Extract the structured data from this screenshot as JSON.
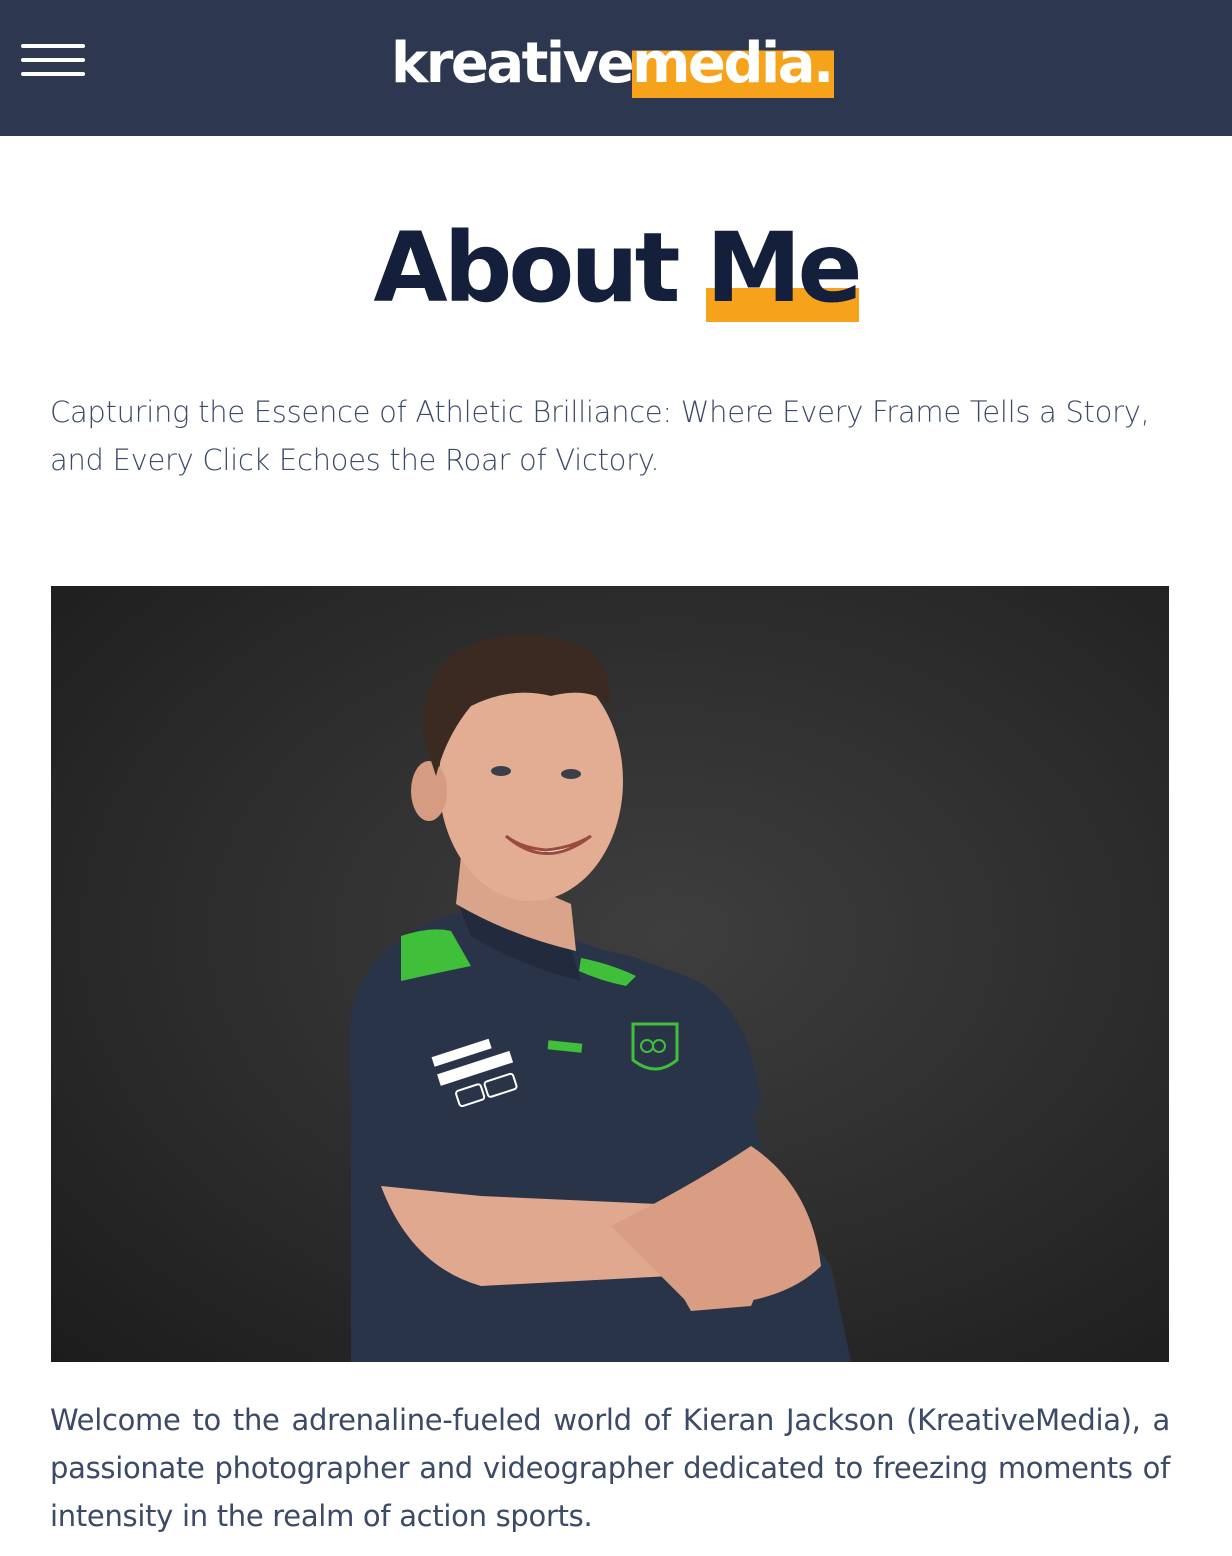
{
  "header": {
    "logo_primary": "kreative",
    "logo_accent": "media.",
    "menu_icon": "hamburger-menu-icon"
  },
  "page": {
    "title_main": "About ",
    "title_highlight": "Me",
    "tagline": "Capturing the Essence of Athletic Brilliance: Where Every Frame Tells a Story, and Every Click Echoes the Roar of Victory.",
    "photo_alt": "Smiling athlete with arms crossed wearing a navy team polo shirt",
    "intro": "Welcome to the adrenaline-fueled world of Kieran Jackson (KreativeMedia), a passionate photographer and videographer dedicated to freezing moments of intensity in the realm of action sports."
  },
  "colors": {
    "header_bg": "#2d3750",
    "accent": "#f7a21b",
    "title": "#14203b",
    "body_text": "#3b4a66"
  }
}
